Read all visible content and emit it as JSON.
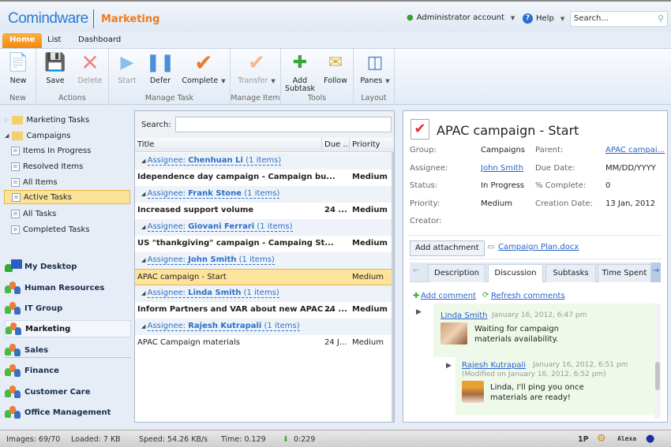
{
  "header": {
    "logo": "Comindware",
    "app_title": "Marketing",
    "account": "Administrator account",
    "help": "Help",
    "search_placeholder": "Search..."
  },
  "tabs": [
    "Home",
    "List",
    "Dashboard"
  ],
  "ribbon": {
    "buttons": {
      "new": "New",
      "save": "Save",
      "delete": "Delete",
      "start": "Start",
      "defer": "Defer",
      "complete": "Complete",
      "transfer": "Transfer",
      "add_subtask": "Add Subtask",
      "follow": "Follow",
      "panes": "Panes"
    },
    "groups": [
      "New",
      "Actions",
      "Manage Task",
      "Manage Item",
      "Tools",
      "Layout"
    ]
  },
  "sidebar": {
    "tree": [
      "Marketing Tasks",
      "Campaigns",
      "Items In Progress",
      "Resolved Items",
      "All Items",
      "Active Tasks",
      "All Tasks",
      "Completed Tasks"
    ],
    "nav": [
      "My Desktop",
      "Human Resources",
      "IT Group",
      "Marketing",
      "Sales",
      "Finance",
      "Customer Care",
      "Office Management"
    ]
  },
  "list": {
    "search_label": "Search:",
    "columns": [
      "Title",
      "Due ...",
      "Priority"
    ],
    "assignee_prefix": "Assignee:",
    "groups": [
      {
        "name": "Chenhuan Li",
        "count": "(1 items)",
        "title": "Idependence day campaign - Campaign bu...",
        "due": "",
        "priority": "Medium"
      },
      {
        "name": "Frank Stone",
        "count": "(1 items)",
        "title": "Increased support volume",
        "due": "24 ...",
        "priority": "Medium"
      },
      {
        "name": "Giovani Ferrari",
        "count": "(1 items)",
        "title": "US \"thankgiving\" campaign - Campaing St...",
        "due": "",
        "priority": "Medium"
      },
      {
        "name": "John Smith",
        "count": "(1 items)",
        "title": "APAC campaign - Start",
        "due": "",
        "priority": "Medium"
      },
      {
        "name": "Linda Smith",
        "count": "(1 items)",
        "title": "Inform Partners and VAR about new APAC ...",
        "due": "24 ...",
        "priority": "Medium"
      },
      {
        "name": "Rajesh Kutrapali",
        "count": "(1 items)",
        "title": "APAC Campaign materials",
        "due": "24 J...",
        "priority": "Medium"
      }
    ]
  },
  "detail": {
    "title": "APAC campaign - Start",
    "fields": {
      "group_l": "Group:",
      "group": "Campaigns",
      "parent_l": "Parent:",
      "parent": "APAC campai...",
      "assignee_l": "Assignee:",
      "assignee": "John Smith",
      "due_l": "Due Date:",
      "due": "MM/DD/YYYY",
      "status_l": "Status:",
      "status": "In Progress",
      "complete_l": "% Complete:",
      "complete": "0",
      "priority_l": "Priority:",
      "priority": "Medium",
      "created_l": "Creation Date:",
      "created": "13 Jan, 2012",
      "creator_l": "Creator:"
    },
    "add_attachment": "Add attachment",
    "attachment": "Campaign Plan.docx",
    "tabs": [
      "Description",
      "Discussion",
      "Subtasks",
      "Time Spent"
    ],
    "add_comment": "Add comment",
    "refresh_comments": "Refresh comments",
    "comments": [
      {
        "author": "Linda Smith",
        "date": "January 16, 2012, 6:47 pm",
        "text": "Waiting for campaign materials availability."
      },
      {
        "author": "Rajesh Kutrapali",
        "date": "January 16, 2012, 6:51 pm",
        "modified": "(Modified on January 16, 2012, 6:52 pm)",
        "text": "Linda, I'll ping you once materials are ready!"
      }
    ]
  },
  "status": {
    "images": "Images: 69/70",
    "loaded": "Loaded: 7 KB",
    "speed": "Speed: 54.26 KB/s",
    "time": "Time: 0.129",
    "timer": "0:229",
    "p1": "1P",
    "alexa": "Alexa"
  }
}
